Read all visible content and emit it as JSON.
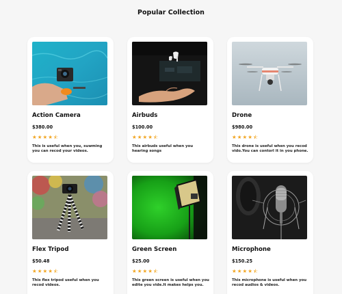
{
  "section": {
    "title": "Popular Collection"
  },
  "colors": {
    "star": "#f2a623",
    "card_bg": "#ffffff",
    "page_bg": "#f6f6f6"
  },
  "products": [
    {
      "name": "Action Camera",
      "price": "$380.00",
      "rating": 4.5,
      "description": "This is useful when you, suwming you can recod your videos.",
      "image": "action-camera-underwater-image"
    },
    {
      "name": "Airbuds",
      "price": "$100.00",
      "rating": 4.5,
      "description": "This airbuds useful when you hearing songs",
      "image": "airbuds-hand-image"
    },
    {
      "name": "Drone",
      "price": "$980.00",
      "rating": 4.5,
      "description": "This drone is useful when you recod vido.You can contorl it in you phone.",
      "image": "drone-sky-image"
    },
    {
      "name": "Flex Tripod",
      "price": "$50.48",
      "rating": 4.5,
      "description": "This flex tripod useful when you recod videos.",
      "image": "flex-tripod-image"
    },
    {
      "name": "Green Screen",
      "price": "$25.00",
      "rating": 4.5,
      "description": "This green screen is useful when you edite you vide.It makes helps you.",
      "image": "green-screen-studio-image"
    },
    {
      "name": "Microphone",
      "price": "$150.25",
      "rating": 4.5,
      "description": "This microphone is useful when you recod audios & videos.",
      "image": "studio-microphone-image"
    }
  ]
}
